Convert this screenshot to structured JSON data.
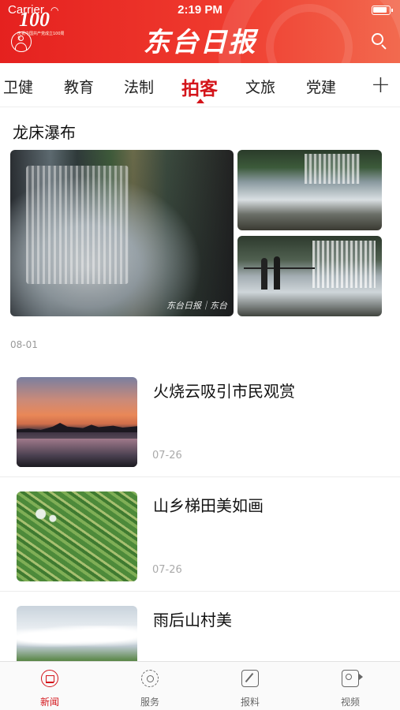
{
  "status_bar": {
    "carrier": "Carrier",
    "time": "2:19 PM"
  },
  "header": {
    "badge_number": "100",
    "badge_subtext": "庆祝中国共产党成立100周年",
    "logo_text": "东台日报"
  },
  "tabs": [
    {
      "label": "卫健",
      "active": false
    },
    {
      "label": "教育",
      "active": false
    },
    {
      "label": "法制",
      "active": false
    },
    {
      "label": "拍客",
      "active": true
    },
    {
      "label": "文旅",
      "active": false
    },
    {
      "label": "党建",
      "active": false
    }
  ],
  "tabs_more": "+",
  "album": {
    "title": "龙床瀑布",
    "watermark": "东台日报｜东台",
    "date": "08-01"
  },
  "items": [
    {
      "title": "火烧云吸引市民观赏",
      "date": "07-26"
    },
    {
      "title": "山乡梯田美如画",
      "date": "07-26"
    },
    {
      "title": "雨后山村美",
      "date": ""
    }
  ],
  "bottom_nav": [
    {
      "label": "新闻",
      "icon": "news-icon",
      "active": true
    },
    {
      "label": "服务",
      "icon": "service-icon",
      "active": false
    },
    {
      "label": "报料",
      "icon": "report-icon",
      "active": false
    },
    {
      "label": "视频",
      "icon": "video-icon",
      "active": false
    }
  ],
  "colors": {
    "brand_red": "#d4141a",
    "header_red": "#e5211f"
  }
}
